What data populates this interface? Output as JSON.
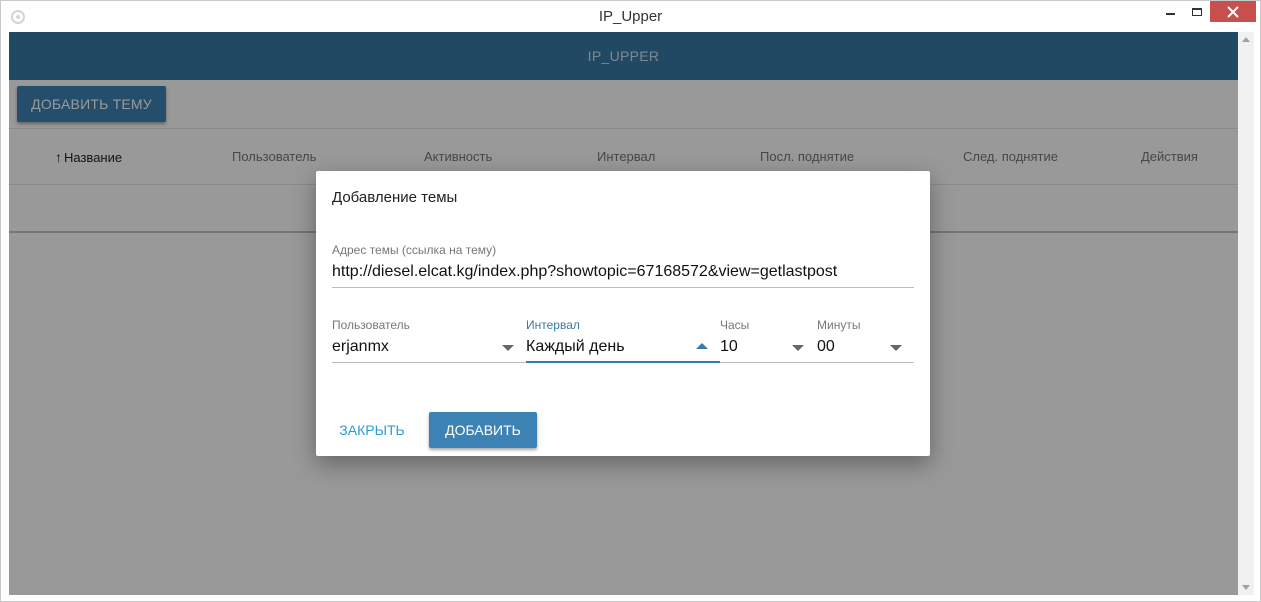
{
  "window": {
    "title": "IP_Upper"
  },
  "app": {
    "header_title": "IP_UPPER",
    "add_topic_label": "ДОБАВИТЬ ТЕМУ"
  },
  "table": {
    "sort_icon": "arrow-up-icon",
    "columns": [
      "Название",
      "Пользователь",
      "Активность",
      "Интервал",
      "Посл. поднятие",
      "След. поднятие",
      "Действия"
    ]
  },
  "dialog": {
    "title": "Добавление темы",
    "url": {
      "label": "Адрес темы (ссылка на тему)",
      "value": "http://diesel.elcat.kg/index.php?showtopic=67168572&view=getlastpost"
    },
    "user": {
      "label": "Пользователь",
      "value": "erjanmx"
    },
    "interval": {
      "label": "Интервал",
      "value": "Каждый день"
    },
    "hours": {
      "label": "Часы",
      "value": "10"
    },
    "minutes": {
      "label": "Минуты",
      "value": "00"
    },
    "close_label": "ЗАКРЫТЬ",
    "add_label": "ДОБАВИТЬ"
  },
  "colors": {
    "appbar": "#3a7aa6",
    "primary_button": "#3c82b4",
    "link_button": "#2b9dd6",
    "window_close": "#c7504f"
  }
}
